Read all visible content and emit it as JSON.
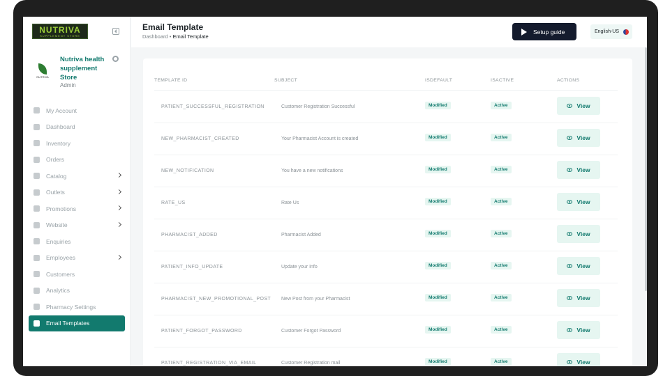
{
  "logo": {
    "title": "NUTRIVA",
    "subtitle": "SUPPLEMENT STORE"
  },
  "store": {
    "name": "Nutriva health supplement Store",
    "role": "Admin",
    "avatar_text": "NUTRIVA"
  },
  "sidebar": {
    "items": [
      {
        "label": "My Account",
        "icon": "user-icon",
        "has_submenu": false
      },
      {
        "label": "Dashboard",
        "icon": "dashboard-icon",
        "has_submenu": false
      },
      {
        "label": "Inventory",
        "icon": "inventory-icon",
        "has_submenu": false
      },
      {
        "label": "Orders",
        "icon": "orders-icon",
        "has_submenu": false
      },
      {
        "label": "Catalog",
        "icon": "catalog-icon",
        "has_submenu": true
      },
      {
        "label": "Outlets",
        "icon": "outlets-icon",
        "has_submenu": true
      },
      {
        "label": "Promotions",
        "icon": "promotions-icon",
        "has_submenu": true
      },
      {
        "label": "Website",
        "icon": "globe-icon",
        "has_submenu": true
      },
      {
        "label": "Enquiries",
        "icon": "enquiries-icon",
        "has_submenu": false
      },
      {
        "label": "Employees",
        "icon": "employees-icon",
        "has_submenu": true
      },
      {
        "label": "Customers",
        "icon": "customers-icon",
        "has_submenu": false
      },
      {
        "label": "Analytics",
        "icon": "analytics-icon",
        "has_submenu": false
      },
      {
        "label": "Pharmacy Settings",
        "icon": "settings-icon",
        "has_submenu": false
      },
      {
        "label": "Email Templates",
        "icon": "email-icon",
        "has_submenu": false,
        "active": true
      }
    ]
  },
  "header": {
    "title": "Email Template",
    "breadcrumb": {
      "root": "Dashboard",
      "separator": "•",
      "current": "Email Template"
    },
    "setup_label": "Setup guide",
    "language": "English-US"
  },
  "table": {
    "columns": [
      "TEMPLATE ID",
      "SUBJECT",
      "ISDEFAULT",
      "ISACTIVE",
      "ACTIONS"
    ],
    "rows": [
      {
        "id": "PATIENT_SUCCESSFUL_REGISTRATION",
        "subject": "Customer Registration Successful",
        "isdefault": "Modified",
        "isactive": "Active",
        "action": "View"
      },
      {
        "id": "NEW_PHARMACIST_CREATED",
        "subject": "Your Pharmacist Account is created",
        "isdefault": "Modified",
        "isactive": "Active",
        "action": "View"
      },
      {
        "id": "NEW_NOTIFICATION",
        "subject": "You have a new notifications",
        "isdefault": "Modified",
        "isactive": "Active",
        "action": "View"
      },
      {
        "id": "RATE_US",
        "subject": "Rate Us",
        "isdefault": "Modified",
        "isactive": "Active",
        "action": "View"
      },
      {
        "id": "PHARMACIST_ADDED",
        "subject": "Pharmacist Added",
        "isdefault": "Modified",
        "isactive": "Active",
        "action": "View"
      },
      {
        "id": "PATIENT_INFO_UPDATE",
        "subject": "Update your Info",
        "isdefault": "Modified",
        "isactive": "Active",
        "action": "View"
      },
      {
        "id": "PHARMACIST_NEW_PROMOTIONAL_POST",
        "subject": "New Post from your Pharmacist",
        "isdefault": "Modified",
        "isactive": "Active",
        "action": "View"
      },
      {
        "id": "PATIENT_FORGOT_PASSWORD",
        "subject": "Customer Forgot Password",
        "isdefault": "Modified",
        "isactive": "Active",
        "action": "View"
      },
      {
        "id": "PATIENT_REGISTRATION_VIA_EMAIL",
        "subject": "Customer Registration mail",
        "isdefault": "Modified",
        "isactive": "Active",
        "action": "View"
      }
    ]
  },
  "colors": {
    "accent": "#127a6e",
    "badge_bg": "#e6f6f1",
    "setup_bg": "#141b2d"
  }
}
